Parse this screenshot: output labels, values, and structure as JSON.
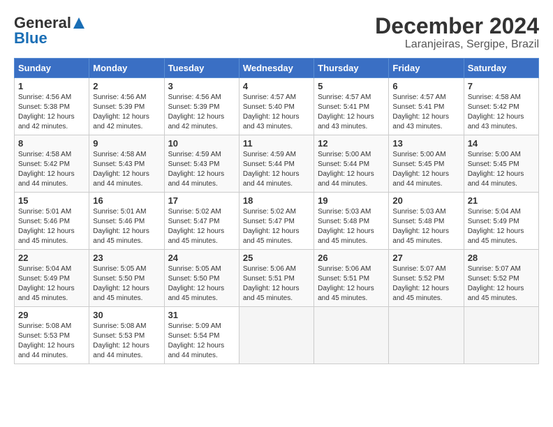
{
  "header": {
    "logo_general": "General",
    "logo_blue": "Blue",
    "title": "December 2024",
    "location": "Laranjeiras, Sergipe, Brazil"
  },
  "days_of_week": [
    "Sunday",
    "Monday",
    "Tuesday",
    "Wednesday",
    "Thursday",
    "Friday",
    "Saturday"
  ],
  "weeks": [
    [
      {
        "num": "1",
        "rise": "4:56 AM",
        "set": "5:38 PM",
        "daylight": "12 hours and 42 minutes."
      },
      {
        "num": "2",
        "rise": "4:56 AM",
        "set": "5:39 PM",
        "daylight": "12 hours and 42 minutes."
      },
      {
        "num": "3",
        "rise": "4:56 AM",
        "set": "5:39 PM",
        "daylight": "12 hours and 42 minutes."
      },
      {
        "num": "4",
        "rise": "4:57 AM",
        "set": "5:40 PM",
        "daylight": "12 hours and 43 minutes."
      },
      {
        "num": "5",
        "rise": "4:57 AM",
        "set": "5:41 PM",
        "daylight": "12 hours and 43 minutes."
      },
      {
        "num": "6",
        "rise": "4:57 AM",
        "set": "5:41 PM",
        "daylight": "12 hours and 43 minutes."
      },
      {
        "num": "7",
        "rise": "4:58 AM",
        "set": "5:42 PM",
        "daylight": "12 hours and 43 minutes."
      }
    ],
    [
      {
        "num": "8",
        "rise": "4:58 AM",
        "set": "5:42 PM",
        "daylight": "12 hours and 44 minutes."
      },
      {
        "num": "9",
        "rise": "4:58 AM",
        "set": "5:43 PM",
        "daylight": "12 hours and 44 minutes."
      },
      {
        "num": "10",
        "rise": "4:59 AM",
        "set": "5:43 PM",
        "daylight": "12 hours and 44 minutes."
      },
      {
        "num": "11",
        "rise": "4:59 AM",
        "set": "5:44 PM",
        "daylight": "12 hours and 44 minutes."
      },
      {
        "num": "12",
        "rise": "5:00 AM",
        "set": "5:44 PM",
        "daylight": "12 hours and 44 minutes."
      },
      {
        "num": "13",
        "rise": "5:00 AM",
        "set": "5:45 PM",
        "daylight": "12 hours and 44 minutes."
      },
      {
        "num": "14",
        "rise": "5:00 AM",
        "set": "5:45 PM",
        "daylight": "12 hours and 44 minutes."
      }
    ],
    [
      {
        "num": "15",
        "rise": "5:01 AM",
        "set": "5:46 PM",
        "daylight": "12 hours and 45 minutes."
      },
      {
        "num": "16",
        "rise": "5:01 AM",
        "set": "5:46 PM",
        "daylight": "12 hours and 45 minutes."
      },
      {
        "num": "17",
        "rise": "5:02 AM",
        "set": "5:47 PM",
        "daylight": "12 hours and 45 minutes."
      },
      {
        "num": "18",
        "rise": "5:02 AM",
        "set": "5:47 PM",
        "daylight": "12 hours and 45 minutes."
      },
      {
        "num": "19",
        "rise": "5:03 AM",
        "set": "5:48 PM",
        "daylight": "12 hours and 45 minutes."
      },
      {
        "num": "20",
        "rise": "5:03 AM",
        "set": "5:48 PM",
        "daylight": "12 hours and 45 minutes."
      },
      {
        "num": "21",
        "rise": "5:04 AM",
        "set": "5:49 PM",
        "daylight": "12 hours and 45 minutes."
      }
    ],
    [
      {
        "num": "22",
        "rise": "5:04 AM",
        "set": "5:49 PM",
        "daylight": "12 hours and 45 minutes."
      },
      {
        "num": "23",
        "rise": "5:05 AM",
        "set": "5:50 PM",
        "daylight": "12 hours and 45 minutes."
      },
      {
        "num": "24",
        "rise": "5:05 AM",
        "set": "5:50 PM",
        "daylight": "12 hours and 45 minutes."
      },
      {
        "num": "25",
        "rise": "5:06 AM",
        "set": "5:51 PM",
        "daylight": "12 hours and 45 minutes."
      },
      {
        "num": "26",
        "rise": "5:06 AM",
        "set": "5:51 PM",
        "daylight": "12 hours and 45 minutes."
      },
      {
        "num": "27",
        "rise": "5:07 AM",
        "set": "5:52 PM",
        "daylight": "12 hours and 45 minutes."
      },
      {
        "num": "28",
        "rise": "5:07 AM",
        "set": "5:52 PM",
        "daylight": "12 hours and 45 minutes."
      }
    ],
    [
      {
        "num": "29",
        "rise": "5:08 AM",
        "set": "5:53 PM",
        "daylight": "12 hours and 44 minutes."
      },
      {
        "num": "30",
        "rise": "5:08 AM",
        "set": "5:53 PM",
        "daylight": "12 hours and 44 minutes."
      },
      {
        "num": "31",
        "rise": "5:09 AM",
        "set": "5:54 PM",
        "daylight": "12 hours and 44 minutes."
      },
      null,
      null,
      null,
      null
    ]
  ]
}
